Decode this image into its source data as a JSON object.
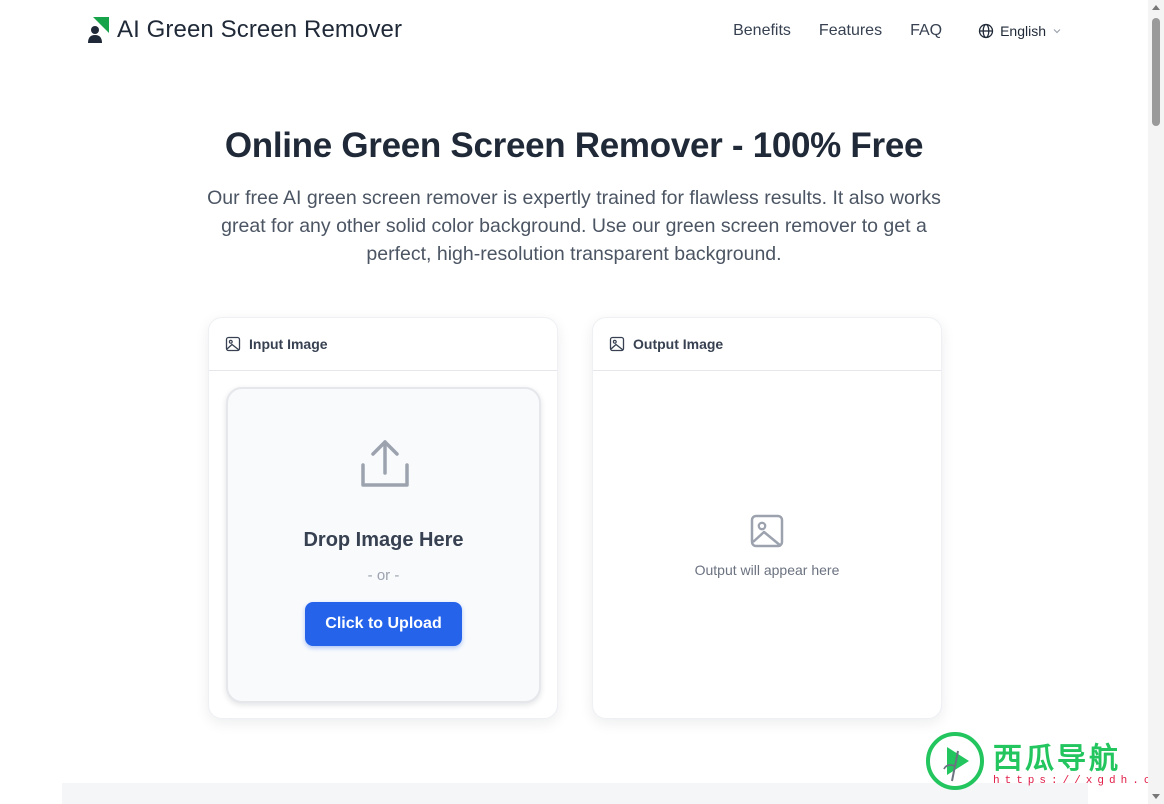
{
  "brand": {
    "name": "AI Green Screen Remover"
  },
  "nav": {
    "items": [
      "Benefits",
      "Features",
      "FAQ"
    ],
    "language": "English"
  },
  "hero": {
    "title": "Online Green Screen Remover - 100% Free",
    "subtitle": "Our free AI green screen remover is expertly trained for flawless results. It also works great for any other solid color background. Use our green screen remover to get a perfect, high-resolution transparent background."
  },
  "input_card": {
    "title": "Input Image",
    "drop_title": "Drop Image Here",
    "or_text": "- or -",
    "upload_label": "Click to Upload"
  },
  "output_card": {
    "title": "Output Image",
    "placeholder": "Output will appear here"
  },
  "watermark": {
    "text": "西瓜导航",
    "url": "https://xgdh.cn"
  },
  "colors": {
    "primary": "#2563eb",
    "brand_green": "#16a34a",
    "text_dark": "#1f2937",
    "text_muted": "#4b5563"
  }
}
